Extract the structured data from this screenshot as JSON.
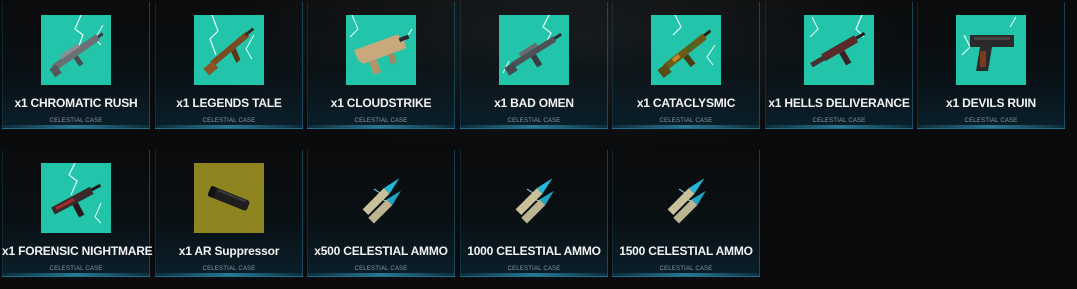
{
  "items": [
    {
      "label": "x1 CHROMATIC RUSH",
      "case": "CELESTIAL CASE",
      "icon": "rifle-icon",
      "bg": "#22c5a9"
    },
    {
      "label": "x1 LEGENDS TALE",
      "case": "CELESTIAL CASE",
      "icon": "ak-rifle-icon",
      "bg": "#22c5a9"
    },
    {
      "label": "x1 CLOUDSTRIKE",
      "case": "CELESTIAL CASE",
      "icon": "bullpup-rifle-icon",
      "bg": "#22c5a9"
    },
    {
      "label": "x1 BAD OMEN",
      "case": "CELESTIAL CASE",
      "icon": "assault-rifle-icon",
      "bg": "#22c5a9"
    },
    {
      "label": "x1 CATACLYSMIC",
      "case": "CELESTIAL CASE",
      "icon": "camo-rifle-icon",
      "bg": "#22c5a9"
    },
    {
      "label": "x1 HELLS DELIVERANCE",
      "case": "CELESTIAL CASE",
      "icon": "smg-icon",
      "bg": "#22c5a9"
    },
    {
      "label": "x1 DEVILS RUIN",
      "case": "CELESTIAL CASE",
      "icon": "pistol-icon",
      "bg": "#22c5a9"
    },
    {
      "label": "x1 FORENSIC NIGHTMARE",
      "case": "CELESTIAL CASE",
      "icon": "compact-smg-icon",
      "bg": "#22c5a9"
    },
    {
      "label": "x1 AR Suppressor",
      "case": "CELESTIAL CASE",
      "icon": "suppressor-icon",
      "bg": "#8e8420"
    },
    {
      "label": "x500 CELESTIAL AMMO",
      "case": "CELESTIAL CASE",
      "icon": "ammo-icon",
      "bg": ""
    },
    {
      "label": "1000 CELESTIAL AMMO",
      "case": "CELESTIAL CASE",
      "icon": "ammo-icon",
      "bg": ""
    },
    {
      "label": "1500 CELESTIAL AMMO",
      "case": "CELESTIAL CASE",
      "icon": "ammo-icon",
      "bg": ""
    }
  ],
  "colors": {
    "accent": "#1e6f8c",
    "teal_bg": "#22c5a9",
    "olive_bg": "#8e8420"
  }
}
